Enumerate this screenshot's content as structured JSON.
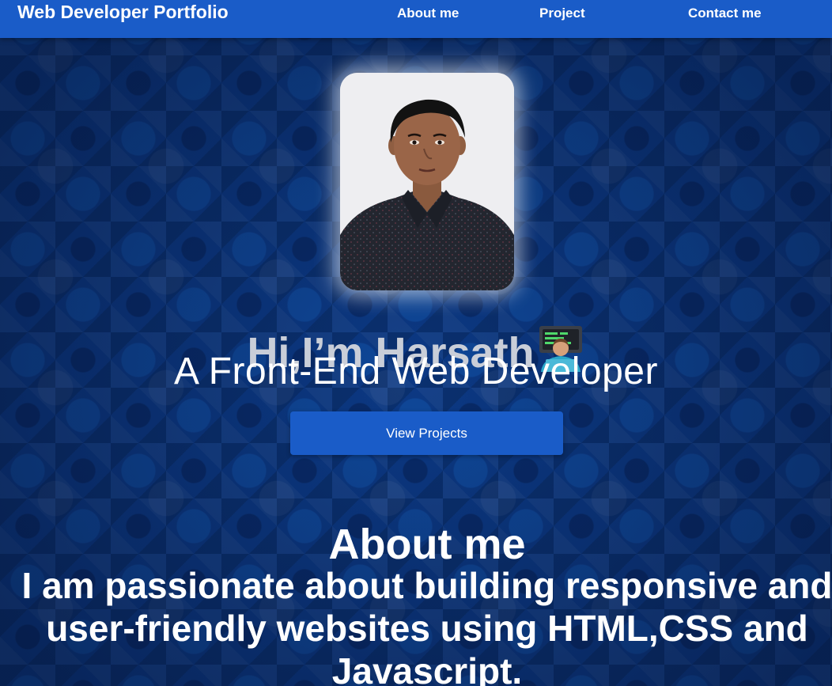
{
  "navbar": {
    "brand": "Web Developer Portfolio",
    "links": [
      {
        "label": "About me"
      },
      {
        "label": "Project"
      },
      {
        "label": "Contact me"
      }
    ],
    "background_color": "#1a5cc8"
  },
  "hero": {
    "greeting": "Hi,I’m Harsath",
    "greeting_emoji": "technologist-emoji",
    "role": "A Front-End Web Developer",
    "cta_label": "View Projects",
    "photo": "profile-photo"
  },
  "about": {
    "title": "About me",
    "text": "I am passionate about building responsive and user-friendly websites using HTML,CSS and Javascript."
  },
  "colors": {
    "accent": "#1a5cc8",
    "background": "#0c3a86",
    "greeting_text": "#c9ced8",
    "text": "#ffffff"
  }
}
